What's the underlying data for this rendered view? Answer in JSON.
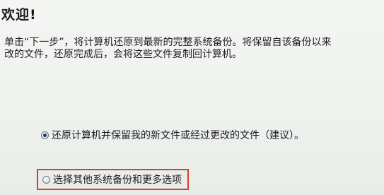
{
  "title": "欢迎!",
  "description": {
    "line1": "单击“下一步”，将计算机还原到最新的完整系统备份。将保留自该备份以来",
    "line2": "改的文件，还原完成后，会将这些文件复制回计算机。"
  },
  "options": [
    {
      "label": "还原计算机并保留我的新文件或经过更改的文件（建议）。",
      "selected": true
    },
    {
      "label": "选择其他系统备份和更多选项",
      "selected": false,
      "highlight_color": "#e0392f"
    }
  ]
}
